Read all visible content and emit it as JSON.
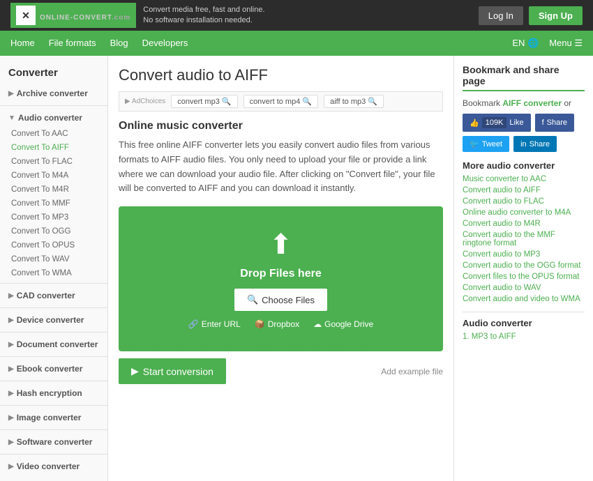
{
  "header": {
    "logo_text": "ONLINE-CONVERT",
    "logo_com": ".com",
    "tagline_line1": "Convert media free, fast and online.",
    "tagline_line2": "No software installation needed.",
    "login_label": "Log In",
    "signup_label": "Sign Up"
  },
  "nav": {
    "items": [
      "Home",
      "File formats",
      "Blog",
      "Developers"
    ],
    "lang": "EN",
    "menu": "Menu"
  },
  "sidebar": {
    "title": "Converter",
    "categories": [
      {
        "id": "archive",
        "label": "Archive converter",
        "expanded": false
      },
      {
        "id": "audio",
        "label": "Audio converter",
        "expanded": true
      },
      {
        "id": "cad",
        "label": "CAD converter",
        "expanded": false
      },
      {
        "id": "device",
        "label": "Device converter",
        "expanded": false
      },
      {
        "id": "document",
        "label": "Document converter",
        "expanded": false
      },
      {
        "id": "ebook",
        "label": "Ebook converter",
        "expanded": false
      },
      {
        "id": "hash",
        "label": "Hash encryption",
        "expanded": false
      },
      {
        "id": "image",
        "label": "Image converter",
        "expanded": false
      },
      {
        "id": "software",
        "label": "Software converter",
        "expanded": false
      },
      {
        "id": "video",
        "label": "Video converter",
        "expanded": false
      }
    ],
    "audio_items": [
      "Convert To AAC",
      "Convert To AIFF",
      "Convert To FLAC",
      "Convert To M4A",
      "Convert To M4R",
      "Convert To MMF",
      "Convert To MP3",
      "Convert To OGG",
      "Convert To OPUS",
      "Convert To WAV",
      "Convert To WMA"
    ]
  },
  "main": {
    "page_title": "Convert audio to AIFF",
    "ad_tag": "AdChoices",
    "ad_chips": [
      "convert mp3",
      "convert to mp4",
      "aiff to mp3"
    ],
    "section_title": "Online music converter",
    "section_desc": "This free online AIFF converter lets you easily convert audio files from various formats to AIFF audio files. You only need to upload your file or provide a link where we can download your audio file. After clicking on \"Convert file\", your file will be converted to AIFF and you can download it instantly.",
    "upload_text": "Drop Files here",
    "choose_files_label": "Choose Files",
    "enter_url_label": "Enter URL",
    "dropbox_label": "Dropbox",
    "google_drive_label": "Google Drive",
    "start_label": "Start conversion",
    "add_example_label": "Add example file"
  },
  "right_sidebar": {
    "bookmark_title": "Bookmark and share page",
    "bookmark_text": "Bookmark ",
    "bookmark_link": "AIFF converter",
    "bookmark_or": " or",
    "like_count": "109K",
    "like_label": "Like",
    "fb_share_label": "Share",
    "tweet_label": "Tweet",
    "in_share_label": "Share",
    "more_title": "More audio converter",
    "more_links": [
      "Music converter to AAC",
      "Convert audio to AIFF",
      "Convert audio to FLAC",
      "Online audio converter to M4A",
      "Convert audio to M4R",
      "Convert audio to the MMF ringtone format",
      "Convert audio to MP3",
      "Convert audio to the OGG format",
      "Convert files to the OPUS format",
      "Convert audio to WAV",
      "Convert audio and video to WMA"
    ],
    "audio_title": "Audio converter",
    "audio_links": [
      "1. MP3 to AIFF"
    ]
  }
}
